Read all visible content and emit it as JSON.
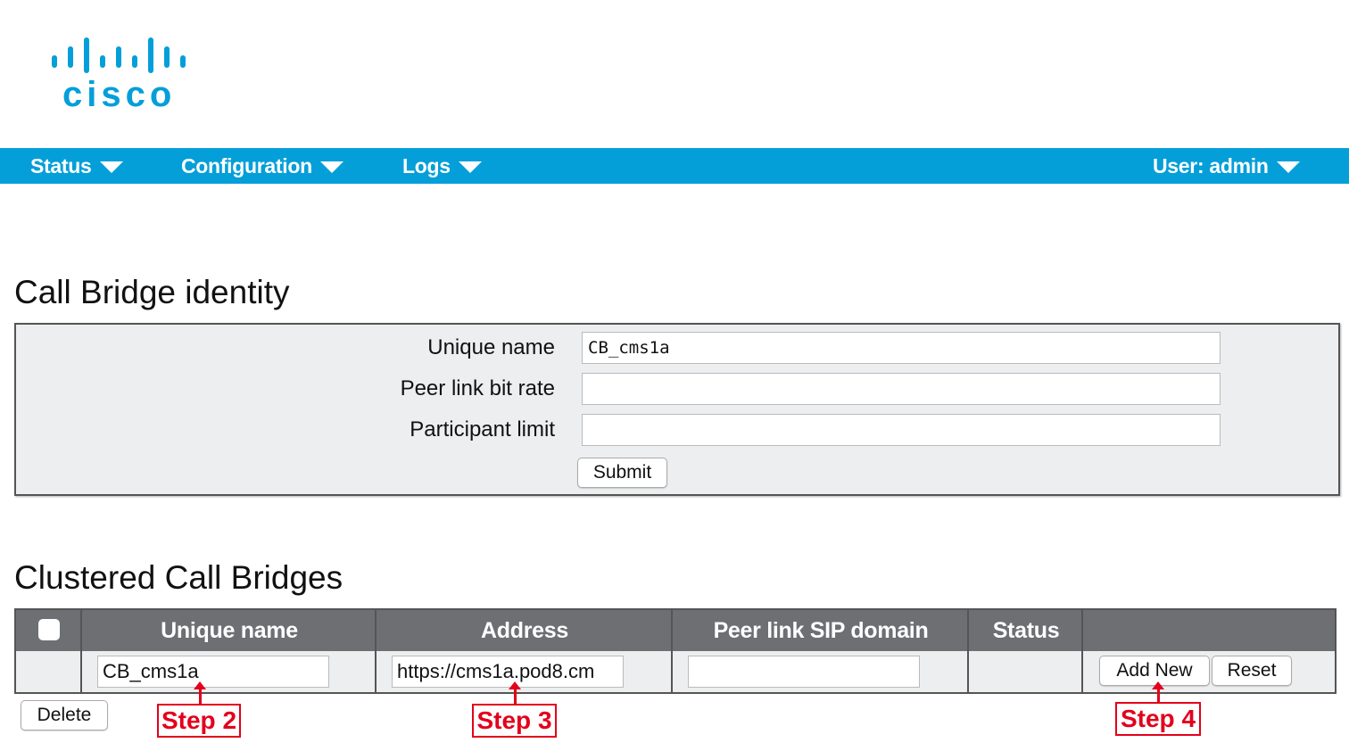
{
  "brand": {
    "logo_text": "cisco",
    "accent_color": "#049fd9"
  },
  "nav": {
    "items": [
      {
        "label": "Status",
        "icon": "caret-down-icon"
      },
      {
        "label": "Configuration",
        "icon": "caret-down-icon"
      },
      {
        "label": "Logs",
        "icon": "caret-down-icon"
      }
    ],
    "user_menu": {
      "label": "User: admin",
      "icon": "caret-down-icon"
    }
  },
  "identity": {
    "title": "Call Bridge identity",
    "fields": [
      {
        "label": "Unique name",
        "value": "CB_cms1a",
        "placeholder": ""
      },
      {
        "label": "Peer link bit rate",
        "value": "",
        "placeholder": ""
      },
      {
        "label": "Participant limit",
        "value": "",
        "placeholder": ""
      }
    ],
    "submit_label": "Submit"
  },
  "cluster": {
    "title": "Clustered Call Bridges",
    "columns": [
      "",
      "Unique name",
      "Address",
      "Peer link SIP domain",
      "Status",
      ""
    ],
    "new_row": {
      "unique_name": "CB_cms1a",
      "address": "https://cms1a.pod8.cm",
      "peer_link_sip_domain": "",
      "status": ""
    },
    "add_new_label": "Add New",
    "reset_label": "Reset",
    "delete_label": "Delete"
  },
  "annotations": {
    "step2": "Step 2",
    "step3": "Step 3",
    "step4": "Step 4",
    "color": "#e3001b"
  }
}
